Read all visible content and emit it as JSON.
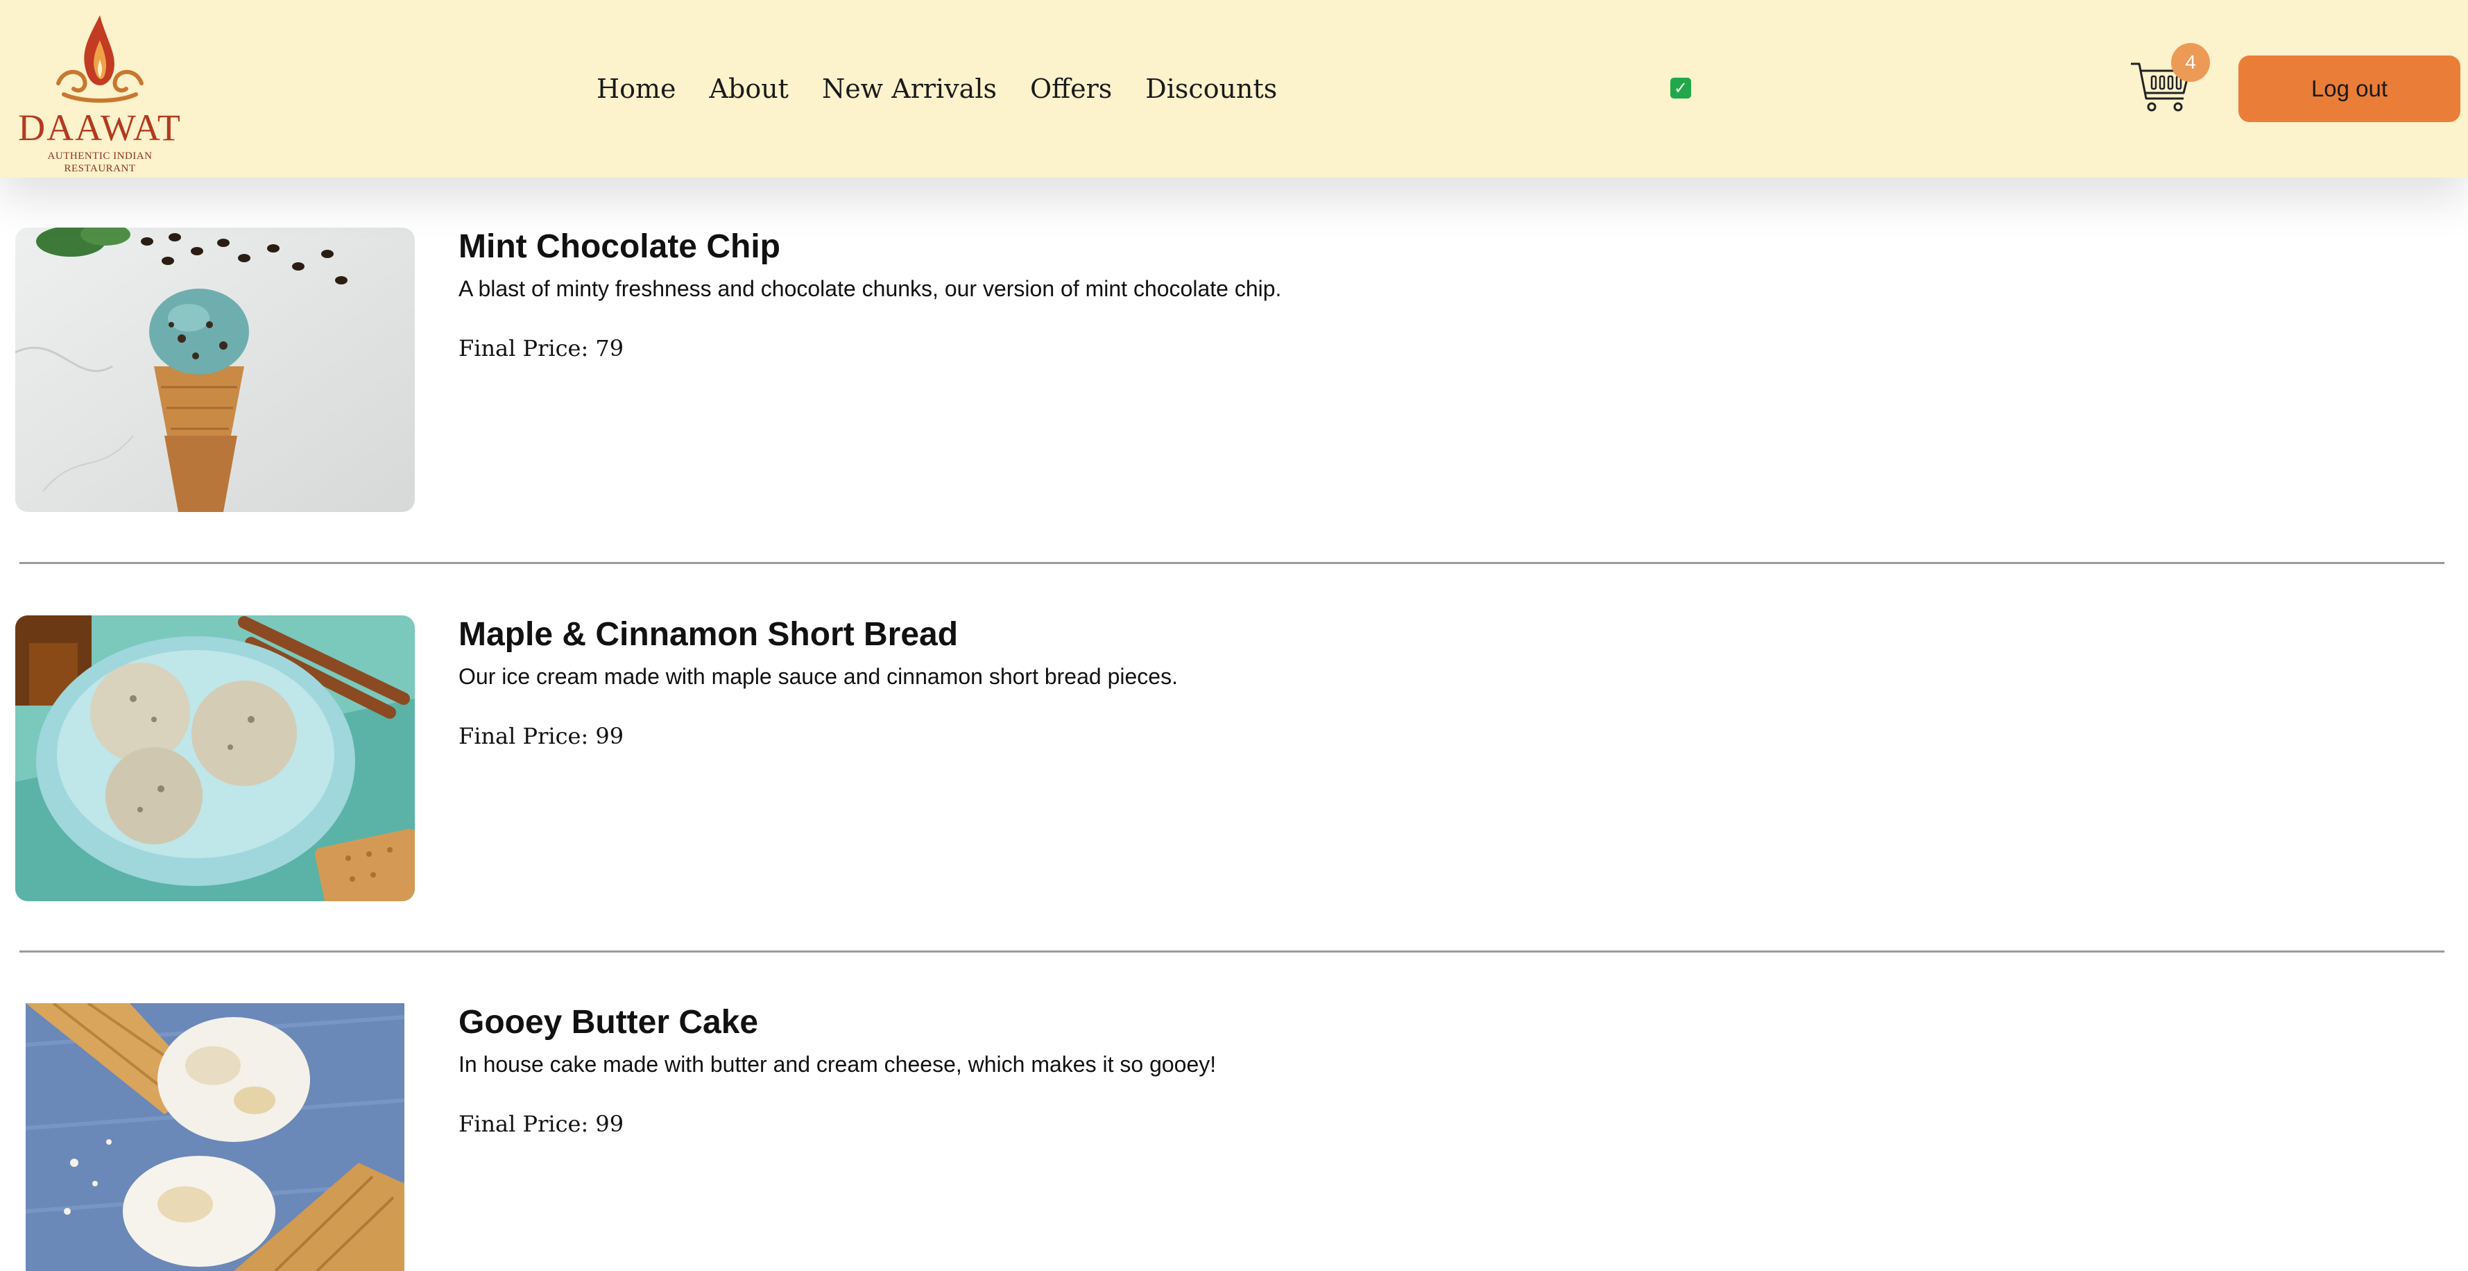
{
  "header": {
    "logo": {
      "name": "DAAWAT",
      "tagline": "AUTHENTIC INDIAN RESTAURANT"
    },
    "nav": [
      {
        "label": "Home"
      },
      {
        "label": "About"
      },
      {
        "label": "New Arrivals"
      },
      {
        "label": "Offers"
      },
      {
        "label": "Discounts"
      }
    ],
    "status_icon": "check-mark-icon",
    "cart": {
      "icon": "shopping-cart-icon",
      "count": "4"
    },
    "logout_label": "Log out"
  },
  "colors": {
    "header_bg": "#fcf2cb",
    "accent": "#ea7d37",
    "badge": "#ec9a55",
    "logo": "#b23a1f"
  },
  "items": [
    {
      "name": "Mint Chocolate Chip",
      "description": "A blast of minty freshness and chocolate chunks, our version of mint chocolate chip.",
      "price_label": "Final Price: 79",
      "image": "mint-ice-cream-cone-image"
    },
    {
      "name": "Maple & Cinnamon Short Bread",
      "description": "Our ice cream made with maple sauce and cinnamon short bread pieces.",
      "price_label": "Final Price: 99",
      "image": "maple-ice-cream-bowl-image"
    },
    {
      "name": "Gooey Butter Cake",
      "description": "In house cake made with butter and cream cheese, which makes it so gooey!",
      "price_label": "Final Price: 99",
      "image": "butter-cake-cones-image"
    }
  ]
}
